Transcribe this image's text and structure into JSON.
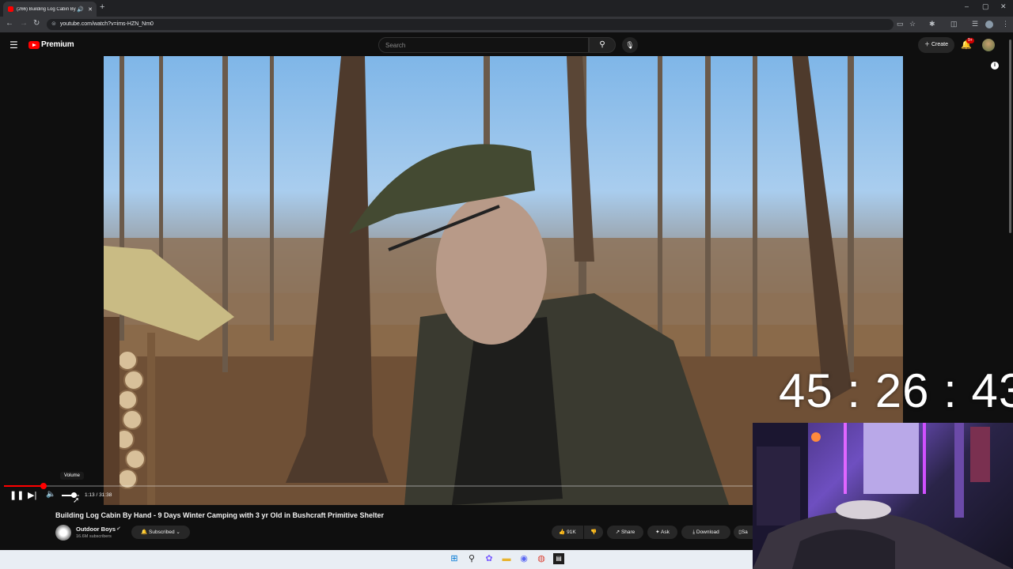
{
  "browser": {
    "tab_title": "(266) Building Log Cabin By",
    "url": "youtube.com/watch?v=ims-HZN_Nm0",
    "new_tab": "+",
    "window_controls": [
      "–",
      "▢",
      "✕"
    ]
  },
  "header": {
    "brand": "Premium",
    "search_placeholder": "Search",
    "create_label": "Create",
    "notification_count": "9+"
  },
  "player": {
    "volume_tooltip": "Volume",
    "time_display": "1:13 / 31:38",
    "progress_fraction": 0.044,
    "volume_fraction": 0.7
  },
  "overlay_clock": "45 : 26 : 43",
  "video": {
    "title": "Building Log Cabin By Hand - 9 Days Winter Camping with 3 yr Old in Bushcraft Primitive Shelter",
    "channel": "Outdoor Boys",
    "subscribers": "16.6M subscribers",
    "subscribe_state": "Subscribed",
    "likes": "91K",
    "share_label": "Share",
    "ask_label": "Ask",
    "download_label": "Download",
    "save_label": "Sa"
  },
  "icons": [
    "menu-icon",
    "youtube-logo-icon",
    "search-icon",
    "mic-icon",
    "plus-icon",
    "bell-icon",
    "info-icon",
    "pause-icon",
    "next-icon",
    "volume-icon",
    "like-icon",
    "dislike-icon",
    "share-icon",
    "ask-icon",
    "download-icon",
    "save-icon",
    "windows-start-icon",
    "taskbar-search-icon",
    "copilot-icon",
    "file-explorer-icon",
    "discord-icon",
    "chrome-icon",
    "terminal-icon"
  ],
  "colors": {
    "accent": "#ff0000",
    "background": "#0f0f0f",
    "pill": "#272727"
  }
}
